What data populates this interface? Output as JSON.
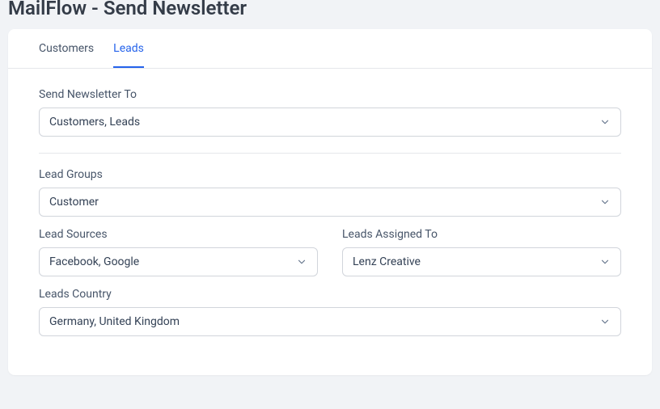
{
  "page": {
    "title": "MailFlow - Send Newsletter"
  },
  "tabs": [
    {
      "id": "customers",
      "label": "Customers",
      "active": false
    },
    {
      "id": "leads",
      "label": "Leads",
      "active": true
    }
  ],
  "form": {
    "send_to": {
      "label": "Send Newsletter To",
      "value": "Customers, Leads"
    },
    "lead_groups": {
      "label": "Lead Groups",
      "value": "Customer"
    },
    "lead_sources": {
      "label": "Lead Sources",
      "value": "Facebook, Google"
    },
    "leads_assigned_to": {
      "label": "Leads Assigned To",
      "value": "Lenz Creative"
    },
    "leads_country": {
      "label": "Leads Country",
      "value": "Germany, United Kingdom"
    }
  }
}
